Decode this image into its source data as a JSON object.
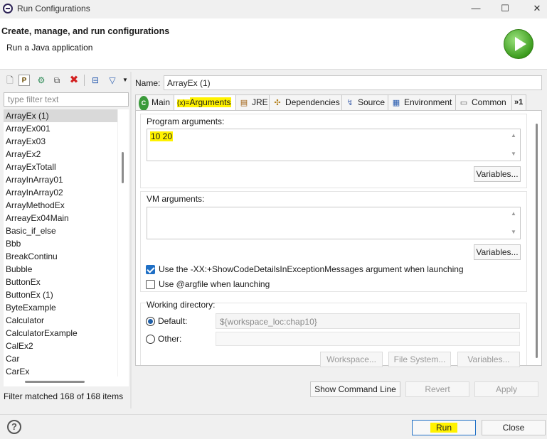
{
  "window": {
    "title": "Run Configurations",
    "minimize": "—",
    "maximize": "☐",
    "close": "✕"
  },
  "header": {
    "title": "Create, manage, and run configurations",
    "subtitle": "Run a Java application"
  },
  "left": {
    "toolbar": [
      "new-config-icon",
      "new-prototype-icon",
      "export-icon",
      "duplicate-icon",
      "delete-icon",
      "collapse-all-icon",
      "filter-icon",
      "view-menu-icon"
    ],
    "filter_placeholder": "type filter text",
    "items": [
      "ArrayEx (1)",
      "ArrayEx001",
      "ArrayEx03",
      "ArrayEx2",
      "ArrayExTotall",
      "ArrayInArray01",
      "ArrayInArray02",
      "ArrayMethodEx",
      "ArreayEx04Main",
      "Basic_if_else",
      "Bbb",
      "BreakContinu",
      "Bubble",
      "ButtonEx",
      "ButtonEx (1)",
      "ByteExample",
      "Calculator",
      "CalculatorExample",
      "CalEx2",
      "Car",
      "CarEx"
    ],
    "selected_index": 0,
    "status": "Filter matched 168 of 168 items"
  },
  "config": {
    "name_label": "Name:",
    "name_value": "ArrayEx (1)",
    "tabs": [
      {
        "label": "Main",
        "icon": "main-tab-icon"
      },
      {
        "label": "Arguments",
        "icon": "arguments-tab-icon",
        "prefix": "(x)="
      },
      {
        "label": "JRE",
        "icon": "jre-tab-icon"
      },
      {
        "label": "Dependencies",
        "icon": "dependencies-tab-icon"
      },
      {
        "label": "Source",
        "icon": "source-tab-icon"
      },
      {
        "label": "Environment",
        "icon": "environment-tab-icon"
      },
      {
        "label": "Common",
        "icon": "common-tab-icon"
      }
    ],
    "more_tabs": "»1",
    "active_tab": "Arguments",
    "program_args_label": "Program arguments:",
    "program_args_value": "10 20",
    "vm_args_label": "VM arguments:",
    "vm_args_value": "",
    "variables_label": "Variables...",
    "show_code_details_label": "Use the -XX:+ShowCodeDetailsInExceptionMessages argument when launching",
    "show_code_details_checked": true,
    "argfile_label": "Use @argfile when launching",
    "argfile_checked": false,
    "working_dir_label": "Working directory:",
    "default_label": "Default:",
    "default_value": "${workspace_loc:chap10}",
    "other_label": "Other:",
    "workspace_button": "Workspace...",
    "filesystem_button": "File System...",
    "wd_variables_button": "Variables..."
  },
  "actions": {
    "show_command_line": "Show Command Line",
    "revert": "Revert",
    "apply": "Apply",
    "run": "Run",
    "close": "Close",
    "help": "?"
  },
  "colors": {
    "highlight": "#fff200",
    "selection": "#d9d9d9",
    "checkbox_accent": "#1f6fc5"
  }
}
